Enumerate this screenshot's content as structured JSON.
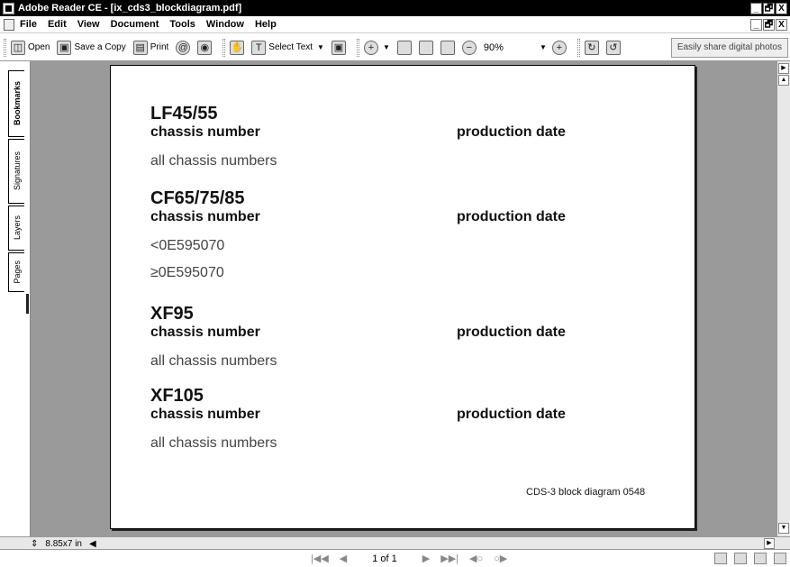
{
  "window": {
    "title": "Adobe Reader CE - [ix_cds3_blockdiagram.pdf]",
    "buttons": [
      "_",
      "🗗",
      "X"
    ]
  },
  "menu": {
    "items": [
      "File",
      "Edit",
      "View",
      "Document",
      "Tools",
      "Window",
      "Help"
    ],
    "doc_buttons": [
      "_",
      "🗗",
      "X"
    ]
  },
  "toolbar": {
    "open": "Open",
    "save_copy": "Save a Copy",
    "print": "Print",
    "select_text": "Select Text",
    "zoom": "90%",
    "promo": "Easily share digital photos"
  },
  "nav_tabs": [
    "Bookmarks",
    "Signatures",
    "Layers",
    "Pages"
  ],
  "document": {
    "sections": [
      {
        "model": "LF45/55",
        "chassis_hdr": "chassis number",
        "date_hdr": "production date",
        "values": [
          "all chassis numbers"
        ]
      },
      {
        "model": "CF65/75/85",
        "chassis_hdr": "chassis number",
        "date_hdr": "production date",
        "values": [
          "<0E595070",
          "≥0E595070"
        ]
      },
      {
        "model": "XF95",
        "chassis_hdr": "chassis number",
        "date_hdr": "production date",
        "values": [
          "all chassis numbers"
        ]
      },
      {
        "model": "XF105",
        "chassis_hdr": "chassis number",
        "date_hdr": "production date",
        "values": [
          "all chassis numbers"
        ]
      }
    ],
    "caption": "CDS-3 block diagram 0548"
  },
  "status": {
    "page_size": "8.85x7 in",
    "page_info": "1 of 1"
  }
}
